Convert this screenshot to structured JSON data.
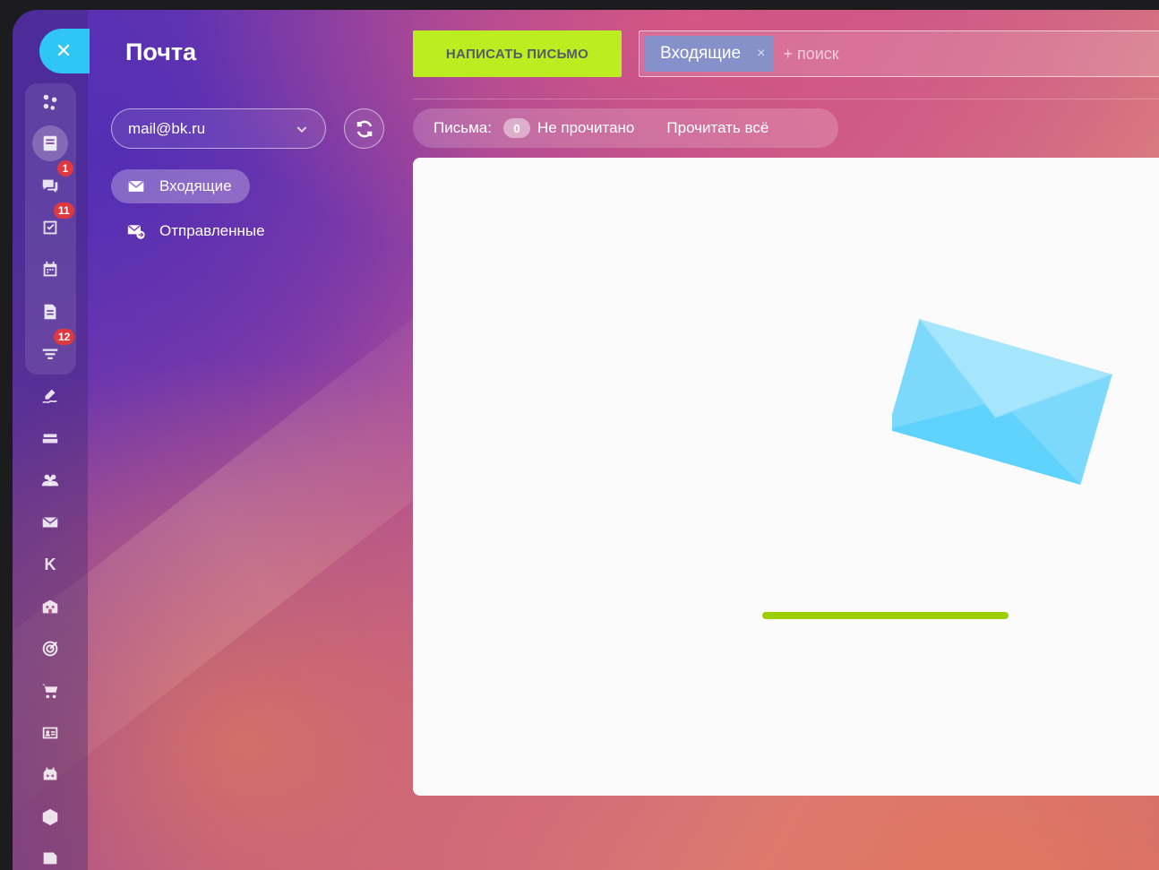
{
  "rail": {
    "close_symbol": "✕",
    "items": [
      {
        "icon": "share-network-icon"
      },
      {
        "icon": "feed-icon",
        "active": true
      },
      {
        "icon": "chat-icon",
        "badge": "1"
      },
      {
        "icon": "tasks-icon",
        "badge": "11"
      },
      {
        "icon": "calendar-icon"
      },
      {
        "icon": "document-icon"
      },
      {
        "icon": "crm-filter-icon",
        "badge": "12"
      },
      {
        "icon": "signature-icon"
      },
      {
        "icon": "inbox-tray-icon"
      },
      {
        "icon": "team-icon"
      },
      {
        "icon": "mail-icon"
      },
      {
        "icon": "k-letter-icon",
        "letter": "K"
      },
      {
        "icon": "building-icon"
      },
      {
        "icon": "target-icon"
      },
      {
        "icon": "cart-icon"
      },
      {
        "icon": "contact-card-icon"
      },
      {
        "icon": "robot-icon"
      },
      {
        "icon": "box-icon"
      },
      {
        "icon": "more-icon"
      }
    ]
  },
  "sidebar": {
    "title": "Почта",
    "account": "mail@bk.ru",
    "folders": [
      {
        "label": "Входящие",
        "active": true
      },
      {
        "label": "Отправленные",
        "active": false
      }
    ]
  },
  "toolbar": {
    "compose_label": "НАПИСАТЬ ПИСЬМО",
    "filter_tag": "Входящие",
    "filter_remove": "×",
    "search_placeholder": "+ поиск"
  },
  "stats": {
    "label": "Письма:",
    "unread_count": "0",
    "unread_label": "Не прочитано",
    "read_all_label": "Прочитать всё"
  },
  "loading": {
    "progress": 0.55
  },
  "colors": {
    "compose": "#bbed21",
    "close": "#2fc6f6",
    "badge": "#e0383f",
    "progress": "#9dcf00",
    "envelope": "#6fd6fa"
  }
}
